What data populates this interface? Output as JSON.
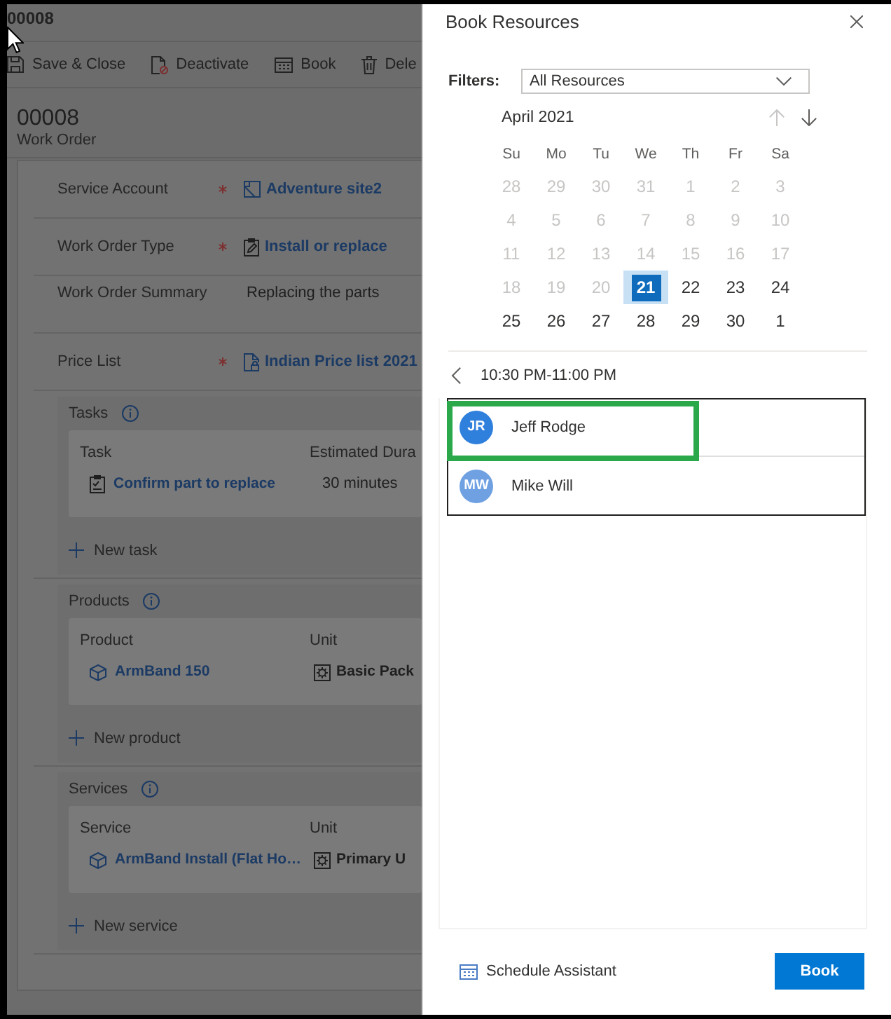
{
  "record_title": "00008",
  "command_bar": [
    {
      "kind": "save",
      "label": "Save & Close"
    },
    {
      "kind": "deactivate",
      "label": "Deactivate"
    },
    {
      "kind": "book",
      "label": "Book"
    },
    {
      "kind": "delete",
      "label": "Dele"
    }
  ],
  "form_header": {
    "title": "00008",
    "entity": "Work Order"
  },
  "fields": [
    {
      "label": "Service Account",
      "required": true,
      "kind": "account",
      "value": "Adventure site2"
    },
    {
      "label": "Work Order Type",
      "required": true,
      "kind": "type",
      "value": "Install or replace"
    },
    {
      "label": "Work Order Summary",
      "required": false,
      "kind": "text",
      "value": "Replacing the parts"
    },
    {
      "label": "Price List",
      "required": true,
      "kind": "price-list",
      "value": "Indian Price list 2021"
    }
  ],
  "subgrids": [
    {
      "title": "Tasks",
      "columns": [
        "Task",
        "Estimated Dura"
      ],
      "rows": [
        [
          {
            "kind": "task",
            "text": "Confirm part to replace"
          },
          {
            "kind": "text",
            "text": "30 minutes"
          }
        ]
      ],
      "new_label": "New task"
    },
    {
      "title": "Products",
      "columns": [
        "Product",
        "Unit"
      ],
      "rows": [
        [
          {
            "kind": "product",
            "text": "ArmBand 150"
          },
          {
            "kind": "unit",
            "text": "Basic Pack"
          }
        ]
      ],
      "new_label": "New product"
    },
    {
      "title": "Services",
      "columns": [
        "Service",
        "Unit"
      ],
      "rows": [
        [
          {
            "kind": "product",
            "text": "ArmBand Install (Flat Ho…"
          },
          {
            "kind": "unit",
            "text": "Primary U"
          }
        ]
      ],
      "new_label": "New service"
    }
  ],
  "booking_panel": {
    "title": "Book Resources",
    "filter_label": "Filters:",
    "filter_value": "All Resources",
    "calendar": {
      "month": "April 2021",
      "nav": [
        {
          "kind": "up",
          "disabled": true
        },
        {
          "kind": "down",
          "disabled": false
        }
      ],
      "weekdays": [
        "Su",
        "Mo",
        "Tu",
        "We",
        "Th",
        "Fr",
        "Sa"
      ],
      "weeks": [
        [
          {
            "day": "28",
            "disabled": true,
            "selected": false
          },
          {
            "day": "29",
            "disabled": true,
            "selected": false
          },
          {
            "day": "30",
            "disabled": true,
            "selected": false
          },
          {
            "day": "31",
            "disabled": true,
            "selected": false
          },
          {
            "day": "1",
            "disabled": true,
            "selected": false
          },
          {
            "day": "2",
            "disabled": true,
            "selected": false
          },
          {
            "day": "3",
            "disabled": true,
            "selected": false
          }
        ],
        [
          {
            "day": "4",
            "disabled": true,
            "selected": false
          },
          {
            "day": "5",
            "disabled": true,
            "selected": false
          },
          {
            "day": "6",
            "disabled": true,
            "selected": false
          },
          {
            "day": "7",
            "disabled": true,
            "selected": false
          },
          {
            "day": "8",
            "disabled": true,
            "selected": false
          },
          {
            "day": "9",
            "disabled": true,
            "selected": false
          },
          {
            "day": "10",
            "disabled": true,
            "selected": false
          }
        ],
        [
          {
            "day": "11",
            "disabled": true,
            "selected": false
          },
          {
            "day": "12",
            "disabled": true,
            "selected": false
          },
          {
            "day": "13",
            "disabled": true,
            "selected": false
          },
          {
            "day": "14",
            "disabled": true,
            "selected": false
          },
          {
            "day": "15",
            "disabled": true,
            "selected": false
          },
          {
            "day": "16",
            "disabled": true,
            "selected": false
          },
          {
            "day": "17",
            "disabled": true,
            "selected": false
          }
        ],
        [
          {
            "day": "18",
            "disabled": true,
            "selected": false
          },
          {
            "day": "19",
            "disabled": true,
            "selected": false
          },
          {
            "day": "20",
            "disabled": true,
            "selected": false
          },
          {
            "day": "21",
            "disabled": false,
            "selected": true
          },
          {
            "day": "22",
            "disabled": false,
            "selected": false
          },
          {
            "day": "23",
            "disabled": false,
            "selected": false
          },
          {
            "day": "24",
            "disabled": false,
            "selected": false
          }
        ],
        [
          {
            "day": "25",
            "disabled": false,
            "selected": false
          },
          {
            "day": "26",
            "disabled": false,
            "selected": false
          },
          {
            "day": "27",
            "disabled": false,
            "selected": false
          },
          {
            "day": "28",
            "disabled": false,
            "selected": false
          },
          {
            "day": "29",
            "disabled": false,
            "selected": false
          },
          {
            "day": "30",
            "disabled": false,
            "selected": false
          },
          {
            "day": "1",
            "disabled": false,
            "selected": false
          }
        ]
      ]
    },
    "timeslot": "10:30 PM-11:00 PM",
    "resources": [
      {
        "initials": "JR",
        "name": "Jeff Rodge",
        "color": "#2f7fdc",
        "highlighted": true
      },
      {
        "initials": "MW",
        "name": "Mike Will",
        "color": "#6fa1e2",
        "highlighted": false
      }
    ],
    "schedule_link": "Schedule Assistant",
    "book_button": "Book"
  }
}
